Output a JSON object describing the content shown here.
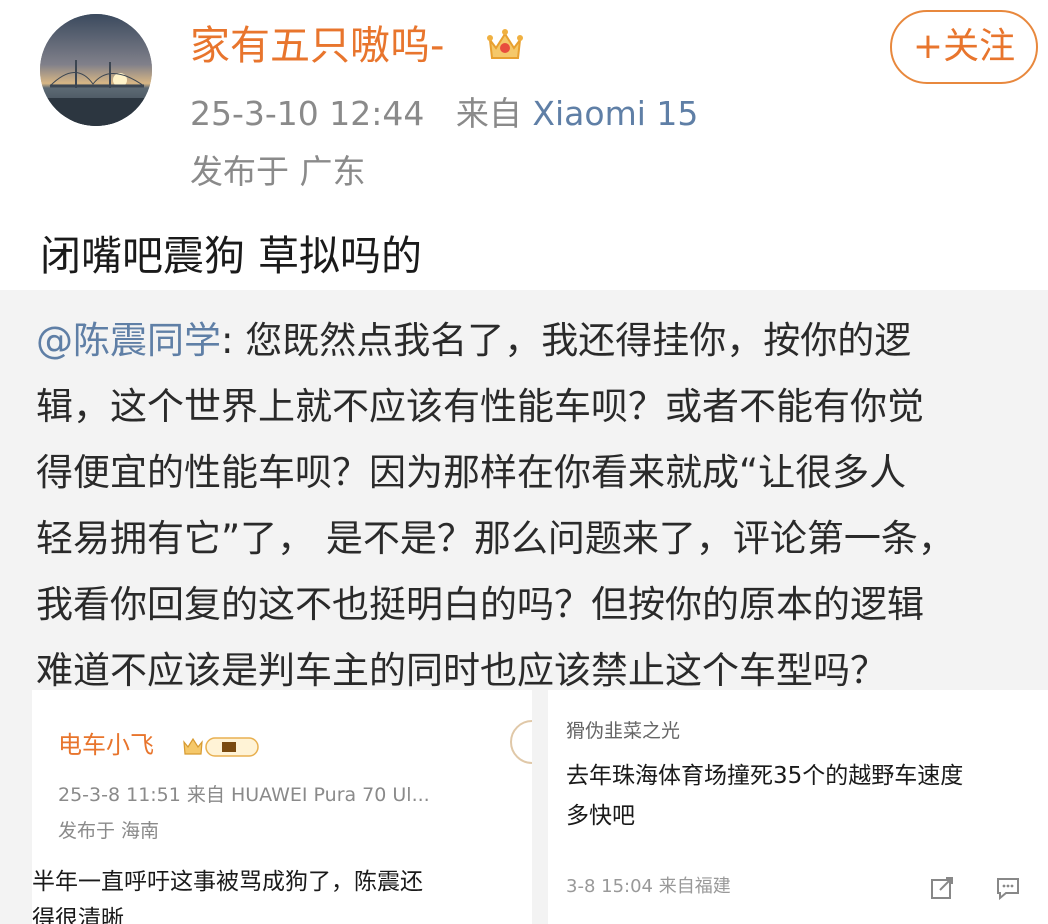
{
  "post": {
    "username": "家有五只嗷呜-",
    "follow_label": "+关注",
    "date": "25-3-10 12:44",
    "from_label": "来自",
    "device": "Xiaomi 15",
    "location": "发布于 广东",
    "text": "闭嘴吧震狗 草拟吗的",
    "icons": {
      "avatar": "avatar-image",
      "crown": "crown-badge-icon"
    }
  },
  "repost": {
    "mention": "@陈震同学",
    "lines": [
      ": 您既然点我名了，我还得挂你，按你的逻",
      "辑，这个世界上就不应该有性能车呗？或者不能有你觉",
      "得便宜的性能车呗？因为那样在你看来就成“让很多人",
      "轻易拥有它”了， 是不是？那么问题来了，评论第一条，",
      "我看你回复的这不也挺明白的吗？但按你的原本的逻辑",
      "难道不应该是判车主的同时也应该禁止这个车型吗？"
    ]
  },
  "card_left": {
    "username": "电车小飞",
    "meta": "25-3-8 11:51  来自 HUAWEI Pura 70 Ul...",
    "location": "发布于 海南",
    "text1": "半年一直呼吁这事被骂成狗了，陈震还",
    "text2": "得很清晰"
  },
  "card_right": {
    "username": "猾伪韭菜之光",
    "text_lines": [
      "去年珠海体育场撞死35个的越野车速度",
      "多快吧"
    ],
    "meta": "3-8 15:04 来自福建",
    "icons": [
      "share-icon",
      "comment-icon"
    ]
  },
  "colors": {
    "accent": "#e8752d",
    "link": "#5f7fa6",
    "repost_bg": "#f3f3f3"
  }
}
